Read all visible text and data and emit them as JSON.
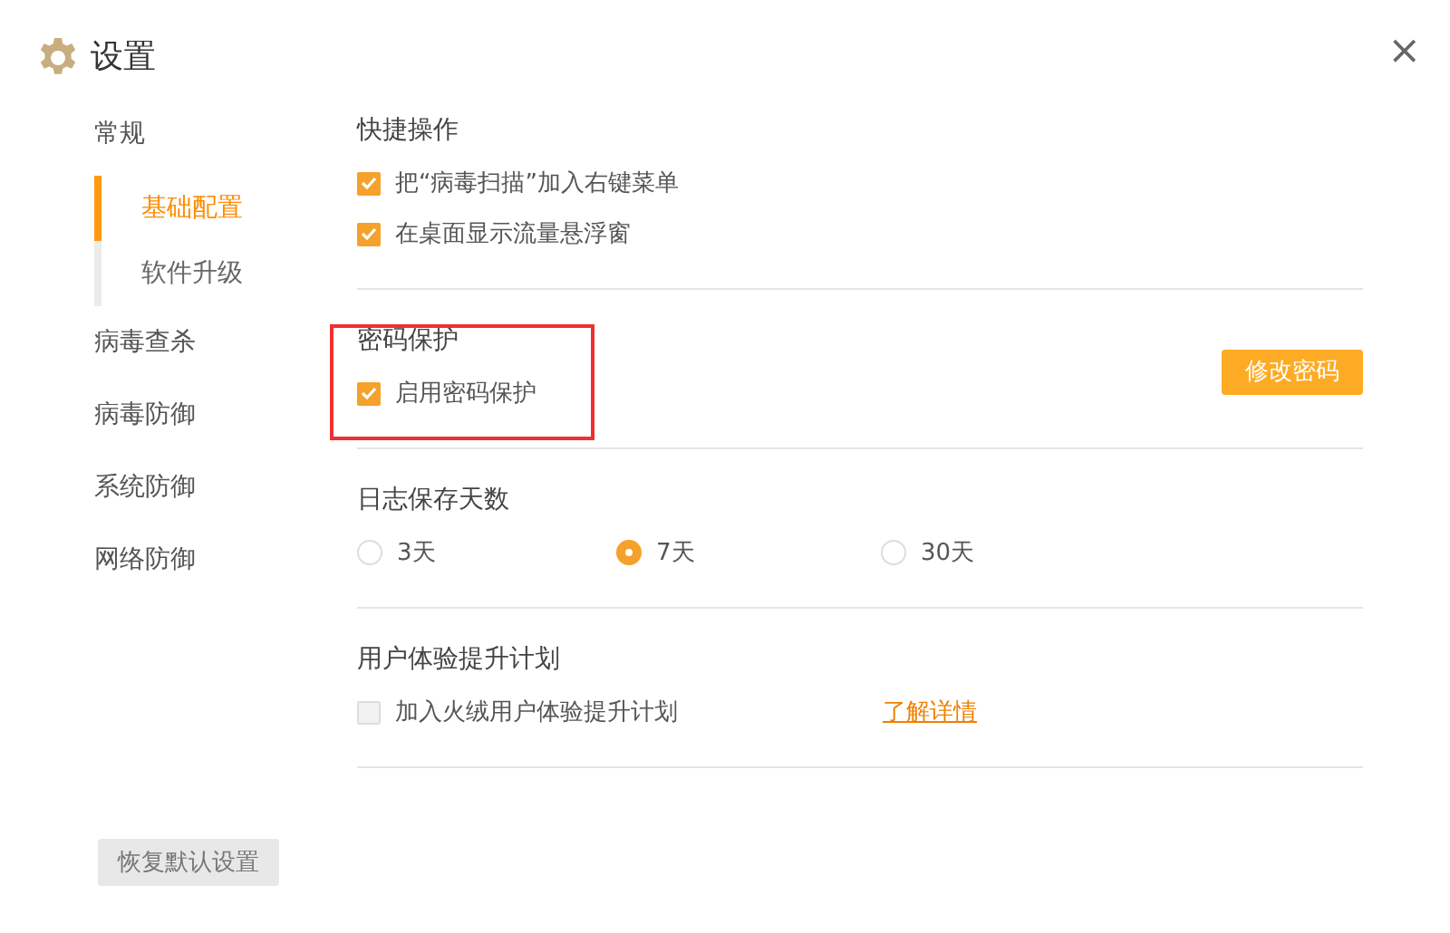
{
  "window": {
    "title": "设置",
    "close": "×"
  },
  "sidebar": {
    "items": [
      {
        "label": "常规",
        "selected": false,
        "children": [
          {
            "label": "基础配置",
            "selected": true
          },
          {
            "label": "软件升级",
            "selected": false
          }
        ]
      },
      {
        "label": "病毒查杀",
        "selected": false
      },
      {
        "label": "病毒防御",
        "selected": false
      },
      {
        "label": "系统防御",
        "selected": false
      },
      {
        "label": "网络防御",
        "selected": false
      }
    ],
    "reset_button": "恢复默认设置"
  },
  "sections": [
    {
      "kind": "checks",
      "title": "快捷操作",
      "highlighted": false,
      "items": [
        {
          "kind": "checkbox",
          "label": "把“病毒扫描”加入右键菜单",
          "checked": true
        },
        {
          "kind": "checkbox",
          "label": "在桌面显示流量悬浮窗",
          "checked": true
        }
      ]
    },
    {
      "kind": "inline",
      "title": "密码保护",
      "highlighted": true,
      "items": [
        {
          "kind": "checkbox",
          "label": "启用密码保护",
          "checked": true
        },
        {
          "kind": "button",
          "label": "修改密码"
        }
      ]
    },
    {
      "kind": "inline",
      "title": "日志保存天数",
      "highlighted": false,
      "items": [
        {
          "kind": "radio",
          "label": "3天",
          "selected": false
        },
        {
          "kind": "radio",
          "label": "7天",
          "selected": true
        },
        {
          "kind": "radio",
          "label": "30天",
          "selected": false
        }
      ]
    },
    {
      "kind": "inline",
      "title": "用户体验提升计划",
      "highlighted": false,
      "items": [
        {
          "kind": "checkbox",
          "label": "加入火绒用户体验提升计划",
          "checked": false
        },
        {
          "kind": "link",
          "label": "了解详情"
        }
      ]
    }
  ]
}
